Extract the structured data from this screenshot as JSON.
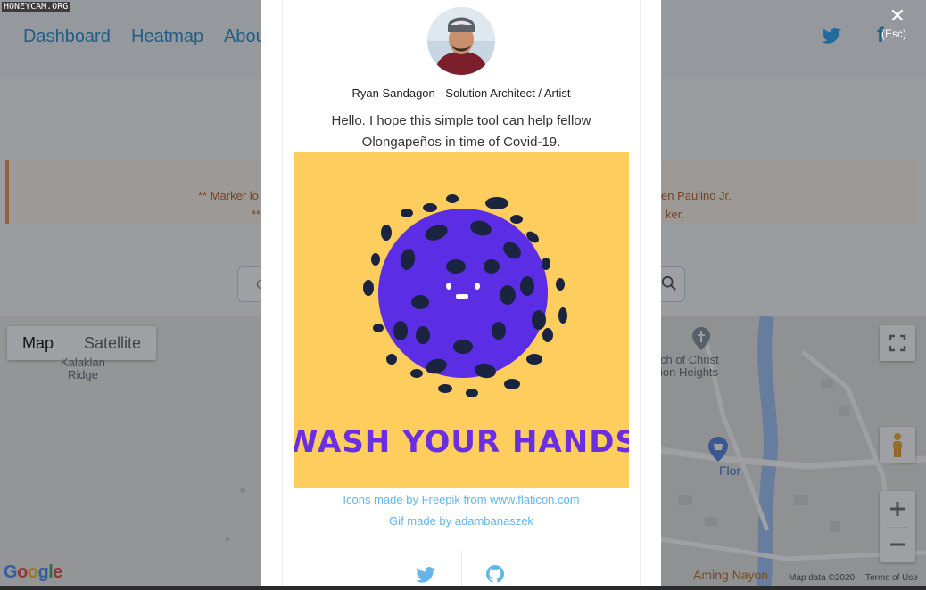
{
  "watermark": "HONEYCAM.ORG",
  "nav": {
    "links": [
      "Dashboard",
      "Heatmap",
      "Abou"
    ],
    "facebook_glyph": "f"
  },
  "alert": {
    "line1_left": "** Marker lo",
    "line1_right": "en Paulino Jr.",
    "line2_left": "**",
    "line2_right": "ker."
  },
  "search": {
    "placeholder": "C"
  },
  "map": {
    "type_buttons": [
      "Map",
      "Satellite"
    ],
    "labels": {
      "kalaklan": "Kalaklan\nRidge",
      "church": "ch of Christ\nion Heights",
      "flor": "Flor",
      "aming": "Aming Nayon"
    },
    "google": [
      "G",
      "o",
      "o",
      "g",
      "l",
      "e"
    ],
    "google_colors": [
      "#4285f4",
      "#ea4335",
      "#fbbc05",
      "#4285f4",
      "#34a853",
      "#ea4335"
    ],
    "footer": {
      "map_data": "Map data ©2020",
      "terms": "Terms of Use"
    }
  },
  "modal": {
    "close_glyph": "✕",
    "esc_label": "(Esc)",
    "author": "Ryan Sandagon - Solution Architect / Artist",
    "intro_line1": "Hello. I hope this simple tool can help fellow",
    "intro_line2": "Olongapeños in time of Covid-19.",
    "gif_text": "WASH YOUR HANDS",
    "credit_icons": "Icons made by Freepik from www.flaticon.com",
    "credit_gif": "Gif made by adambanaszek"
  },
  "colors": {
    "accent": "#1e86c8",
    "twitter": "#1da1f2",
    "link": "#62b6ea",
    "gif_bg": "#fdce5d",
    "virus": "#5b2ee6"
  }
}
